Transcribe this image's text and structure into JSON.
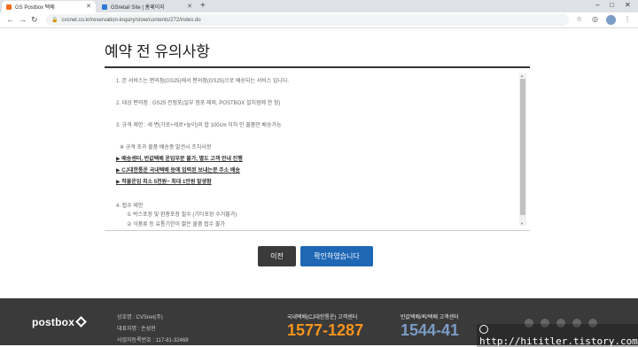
{
  "browser": {
    "tabs": [
      {
        "title": "GS Postbox 택배",
        "active": true
      },
      {
        "title": "GSretail Site | 홈페이지",
        "active": false
      }
    ],
    "url": "cvsnet.co.kr/reservation-inquiry/slow/contents/272/index.do"
  },
  "page": {
    "title": "예약 전 유의사항"
  },
  "notice": {
    "lines": [
      {
        "text": "1. 본 서비스는 편의점(GS25)에서 편의점(GS25)으로 배송되는 서비스 입니다.",
        "style": "plain"
      },
      {
        "text": "2. 대상 편의점 : GS25 전점포(일부 점포 제외, POSTBOX 설치점에 한 함)",
        "style": "plain"
      },
      {
        "text": "3. 규격 제한 : 세 변(가로+세로+높이)의 합 100cm 이하 인 물품만 배송가능",
        "style": "plain"
      },
      {
        "text": "※ 규격 초과 물품 배송중 발견시 조치사항",
        "style": "plain"
      },
      {
        "text": "▶ 배송센터, 반값택배 운임부분 불가, 별도 고객 안내 진행",
        "style": "bold"
      },
      {
        "text": "▶ CJ대한통운 국내택배 등에 입력된 보내는분 주소 배송",
        "style": "bold"
      },
      {
        "text": "▶ 착불운임 최소 5천원~ 최대 1만원 발생함",
        "style": "bold"
      },
      {
        "text": "4. 접수 제한",
        "style": "plain"
      },
      {
        "text": "① 박스포장 및 완충포장 필수 (기타포장 수거불가)",
        "style": "plain"
      },
      {
        "text": "② 식품류 등 유통기한이 짧은 물품 접수 불가",
        "style": "plain"
      }
    ]
  },
  "buttons": {
    "prev": "이전",
    "confirm": "확인하였습니다"
  },
  "footer": {
    "logo": "postbox",
    "company": {
      "name": "상호명 : CVSnet(주)",
      "ceo": "대표자명 : 손성현",
      "bizno": "사업자등록번호 : 117-81-32468"
    },
    "domestic": {
      "label": "국내택배(CJ대한통운) 고객센터",
      "phone": "1577-1287",
      "color": "#f7941d"
    },
    "halfprice": {
      "label": "반값택배/퀵/택배 고객센터",
      "phone": "1544-41",
      "color": "#7a9cc6"
    }
  },
  "watermark": "http://hititler.tistory.com",
  "icons": {
    "back": "back-arrow-icon",
    "forward": "forward-arrow-icon",
    "reload": "reload-icon",
    "lock": "lock-icon",
    "star": "star-icon",
    "menu": "menu-icon"
  }
}
